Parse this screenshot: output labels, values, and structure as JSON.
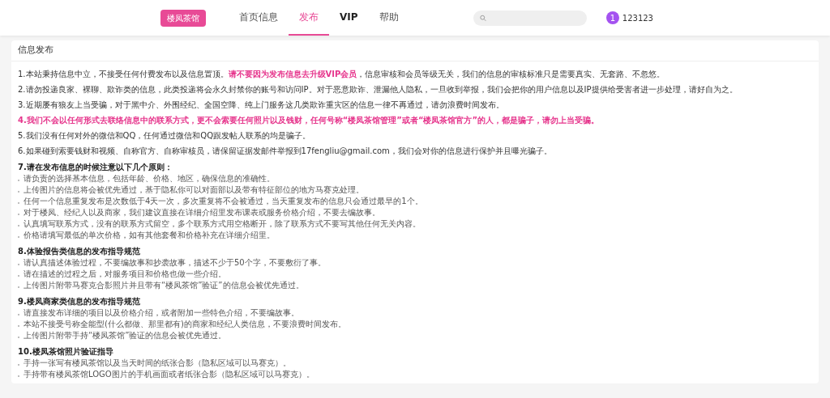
{
  "header": {
    "brand": "楼凤茶馆",
    "nav": [
      {
        "label": "首页信息",
        "selected": false,
        "bold": false
      },
      {
        "label": "发布",
        "selected": true,
        "bold": false
      },
      {
        "label": "VIP",
        "selected": false,
        "bold": true
      },
      {
        "label": "帮助",
        "selected": false,
        "bold": false
      }
    ],
    "user": {
      "avatar": "1",
      "name": "123123"
    }
  },
  "card": {
    "title": "信息发布",
    "blocks": [
      {
        "kind": "paragraph",
        "alert": false,
        "text": "1.本站秉持信息中立，不接受任何付费发布以及信息置顶。**请不要因为发布信息去升级VIP会员**，信息审核和会员等级无关，我们的信息的审核标准只是需要真实、无套路、不忽悠。"
      },
      {
        "kind": "paragraph",
        "alert": false,
        "text": "2.请勿投递良家、裸聊、欺诈类的信息，此类投递将会永久封禁你的账号和访问IP。对于恶意欺诈、泄漏他人隐私，一旦收到举报，我们会把你的用户信息以及IP提供给受害者进一步处理，请好自为之。"
      },
      {
        "kind": "paragraph",
        "alert": false,
        "text": "3.近期屡有狼友上当受骗，对于黑中介、外围经纪、全国空降、纯上门服务这几类欺诈重灾区的信息一律不再通过，请勿浪费时间发布。"
      },
      {
        "kind": "paragraph",
        "alert": true,
        "text": "4.我们不会以任何形式去联络信息中的联系方式，更不会索要任何照片以及钱财，任何号称“楼凤茶馆管理”或者“楼凤茶馆官方”的人，都是骗子，请勿上当受骗。"
      },
      {
        "kind": "paragraph",
        "alert": false,
        "text": "5.我们没有任何对外的微信和QQ，任何通过微信和QQ跟发帖人联系的均是骗子。"
      },
      {
        "kind": "paragraph",
        "alert": false,
        "text": "6.如果碰到索要钱财和视频、自称官方、自称审核员，请保留证据发邮件举报到17fengliu@gmail.com，我们会对你的信息进行保护并且曝光骗子。"
      },
      {
        "kind": "heading",
        "text": "7.请在发布信息的时候注意以下几个原则："
      },
      {
        "kind": "bullet",
        "text": "请负责的选择基本信息，包括年龄、价格、地区，确保信息的准确性。"
      },
      {
        "kind": "bullet",
        "text": "上传图片的信息将会被优先通过，基于隐私你可以对面部以及带有特征部位的地方马赛克处理。"
      },
      {
        "kind": "bullet",
        "text": "任何一个信息重复发布是次数低于4天一次，多次重复将不会被通过，当天重复发布的信息只会通过最早的1个。"
      },
      {
        "kind": "bullet",
        "text": "对于楼凤、经纪人以及商家，我们建议直接在详细介绍里发布课表或服务价格介绍，不要去编故事。"
      },
      {
        "kind": "bullet",
        "text": "认真填写联系方式，没有的联系方式留空，多个联系方式用空格断开，除了联系方式不要写其他任何无关内容。"
      },
      {
        "kind": "bullet",
        "text": "价格请填写最低的单次价格，如有其他套餐和价格补充在详细介绍里。"
      },
      {
        "kind": "heading",
        "text": "8.体验报告类信息的发布指导规范"
      },
      {
        "kind": "bullet",
        "text": "请认真描述体验过程，不要编故事和抄袭故事，描述不少于50个字，不要敷衍了事。"
      },
      {
        "kind": "bullet",
        "text": "请在描述的过程之后，对服务项目和价格也做一些介绍。"
      },
      {
        "kind": "bullet",
        "text": "上传图片附带马赛克合影照片并且带有“楼凤茶馆”验证”的信息会被优先通过。"
      },
      {
        "kind": "heading",
        "text": "9.楼凤商家类信息的发布指导规范"
      },
      {
        "kind": "bullet",
        "text": "请直接发布详细的项目以及价格介绍，或者附加一些特色介绍，不要编故事。"
      },
      {
        "kind": "bullet",
        "text": "本站不接受号称全能型(什么都做、那里都有)的商家和经纪人类信息，不要浪费时间发布。"
      },
      {
        "kind": "bullet",
        "text": "上传图片附带手持“楼凤茶馆”验证的信息会被优先通过。"
      },
      {
        "kind": "heading",
        "text": "10.楼凤茶馆照片验证指导"
      },
      {
        "kind": "bullet",
        "text": "手持一张写有楼凤茶馆以及当天时间的纸张合影（隐私区域可以马赛克）。"
      },
      {
        "kind": "bullet",
        "text": "手持带有楼凤茶馆LOGO图片的手机画面或者纸张合影（隐私区域可以马赛克）。"
      }
    ]
  }
}
